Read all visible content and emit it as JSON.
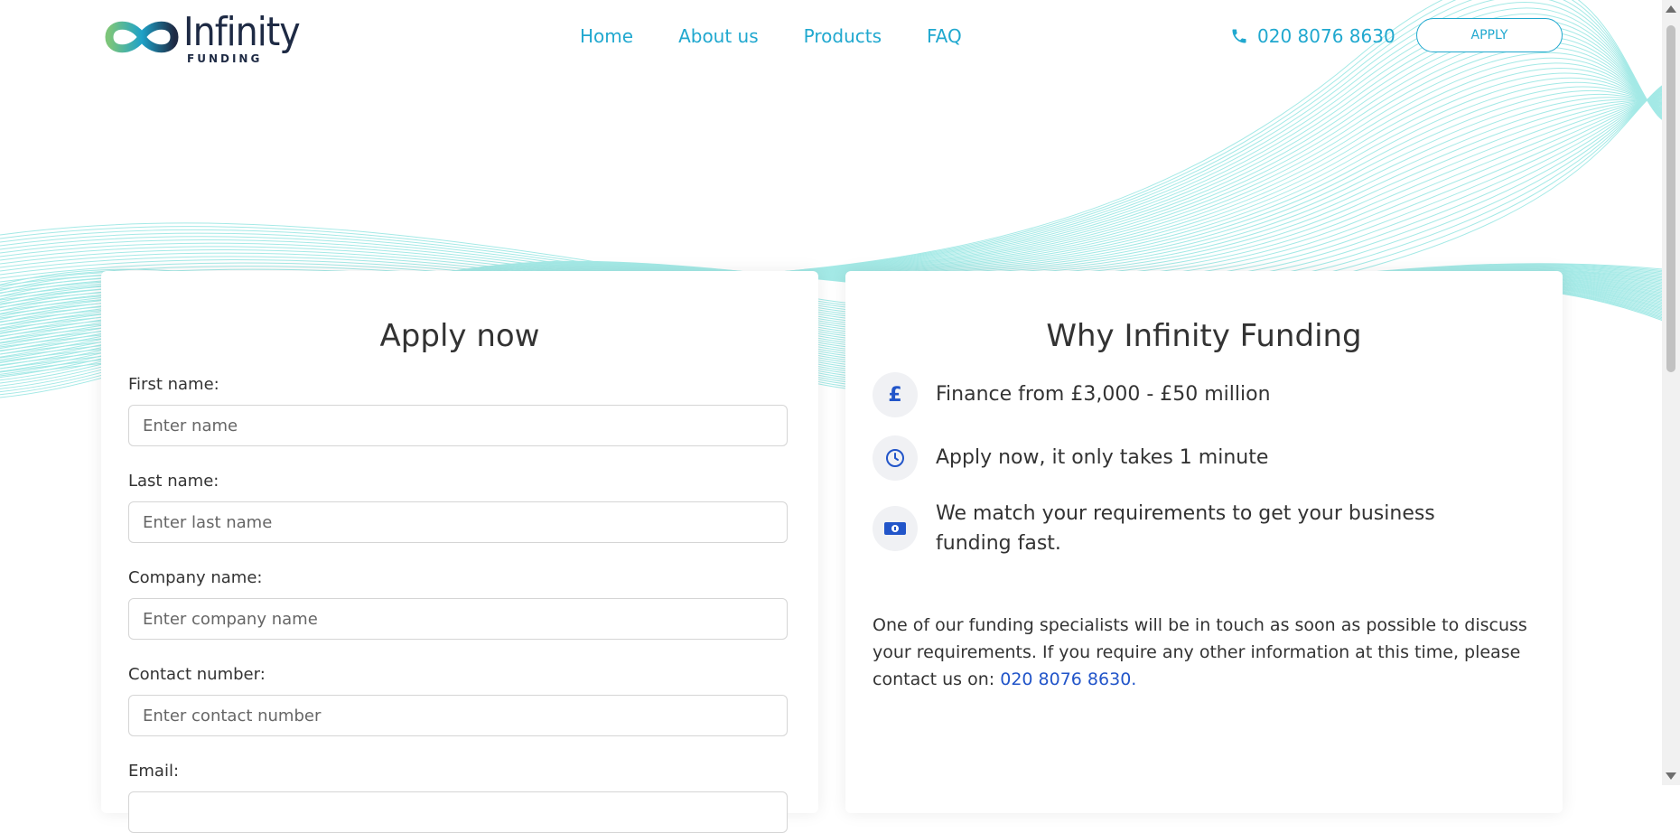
{
  "brand": {
    "name": "Infinity",
    "sub": "FUNDING"
  },
  "nav": {
    "items": [
      {
        "label": "Home"
      },
      {
        "label": "About us"
      },
      {
        "label": "Products"
      },
      {
        "label": "FAQ"
      }
    ]
  },
  "header": {
    "phone": "020 8076 8630",
    "apply_label": "APPLY"
  },
  "form": {
    "title": "Apply now",
    "fields": [
      {
        "label": "First name:",
        "placeholder": "Enter name",
        "value": ""
      },
      {
        "label": "Last name:",
        "placeholder": "Enter last name",
        "value": ""
      },
      {
        "label": "Company name:",
        "placeholder": "Enter company name",
        "value": ""
      },
      {
        "label": "Contact number:",
        "placeholder": "Enter contact number",
        "value": ""
      },
      {
        "label": "Email:",
        "placeholder": "",
        "value": ""
      }
    ]
  },
  "why": {
    "title": "Why Infinity Funding",
    "features": [
      {
        "icon": "pound-icon",
        "text": "Finance from £3,000 - £50 million"
      },
      {
        "icon": "clock-icon",
        "text": "Apply now, it only takes 1 minute"
      },
      {
        "icon": "money-icon",
        "text": "We match your requirements to get your business funding fast."
      }
    ],
    "info_text": "One of our funding specialists will be in touch as soon as possible to discuss your requirements. If you require any other information at this time, please contact us on: ",
    "info_phone": "020 8076 8630."
  },
  "colors": {
    "accent": "#20a8cf",
    "link": "#2255c9",
    "wave": "#4fd6d0"
  }
}
